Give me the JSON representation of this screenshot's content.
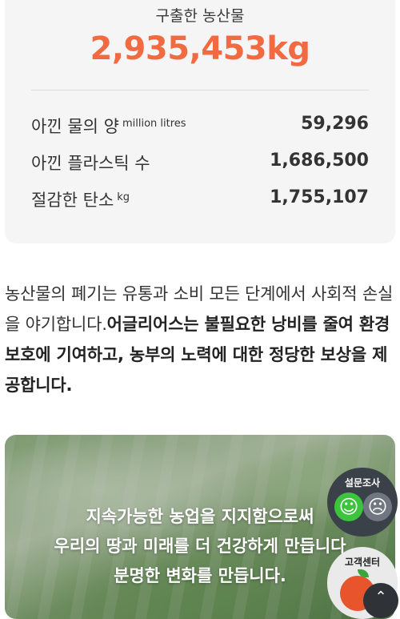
{
  "stats": {
    "rescued_label": "구출한 농산물",
    "rescued_value": "2,935,453kg",
    "rows": [
      {
        "label": "아낀 물의 양",
        "unit": "million litres",
        "value": "59,296"
      },
      {
        "label": "아낀 플라스틱 수",
        "unit": "",
        "value": "1,686,500"
      },
      {
        "label": "절감한 탄소",
        "unit": "kg",
        "value": "1,755,107"
      }
    ]
  },
  "description": {
    "normal": "농산물의 폐기는 유통과 소비 모든 단계에서 사회적 손실을 야기합니다.",
    "bold": "어글리어스는 불필요한 낭비를 줄여 환경 보호에 기여하고, 농부의 노력에 대한 정당한 보상을 제공합니다."
  },
  "hero": {
    "lines": [
      "지속가능한 농업을 지지함으로써",
      "우리의 땅과 미래를 더 건강하게 만듭니다",
      "분명한 변화를 만듭니다."
    ]
  },
  "survey": {
    "title": "설문조사",
    "happy_icon": "smile-face-icon",
    "sad_icon": "frown-face-icon"
  },
  "support": {
    "title": "고객센터",
    "icon": "tomato-mascot-icon"
  },
  "scroll_top": {
    "icon": "arrow-up-icon",
    "glyph": "⌃"
  },
  "colors": {
    "accent": "#f26a42",
    "card_bg": "#f5f5f6",
    "happy": "#3cc43c"
  }
}
